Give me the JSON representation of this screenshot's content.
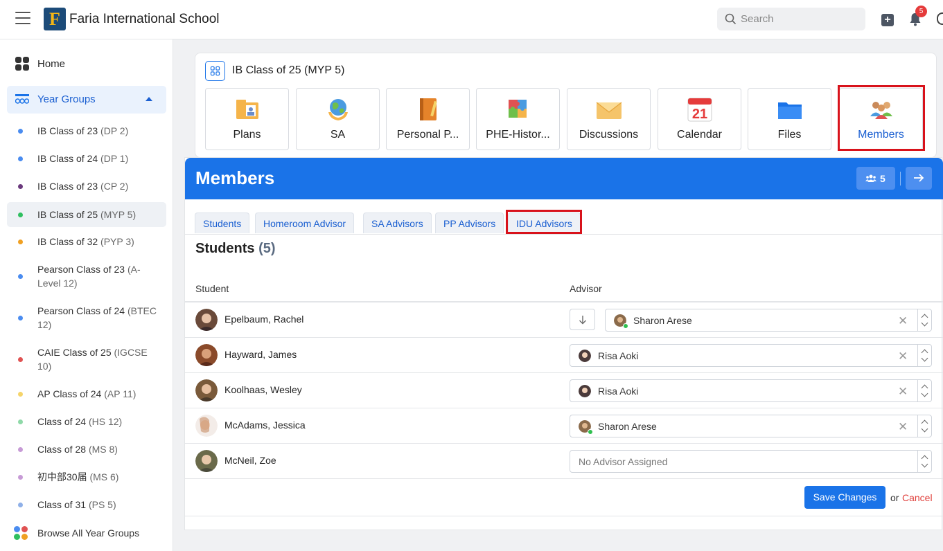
{
  "topbar": {
    "school_name": "Faria International School",
    "logo_letter": "F",
    "search_placeholder": "Search",
    "notification_count": "5"
  },
  "sidebar": {
    "home_label": "Home",
    "year_groups_label": "Year Groups",
    "items": [
      {
        "name": "IB Class of 23",
        "sub": "(DP 2)",
        "color": "#4a8cf0"
      },
      {
        "name": "IB Class of 24",
        "sub": "(DP 1)",
        "color": "#4a8cf0"
      },
      {
        "name": "IB Class of 23",
        "sub": "(CP 2)",
        "color": "#6b3a7d"
      },
      {
        "name": "IB Class of 25",
        "sub": "(MYP 5)",
        "color": "#2fbf60"
      },
      {
        "name": "IB Class of 32",
        "sub": "(PYP 3)",
        "color": "#f0a022"
      },
      {
        "name": "Pearson Class of 23",
        "sub": "(A-Level 12)",
        "color": "#4a8cf0"
      },
      {
        "name": "Pearson Class of 24",
        "sub": "(BTEC 12)",
        "color": "#4a8cf0"
      },
      {
        "name": "CAIE Class of 25",
        "sub": "(IGCSE 10)",
        "color": "#e05252"
      },
      {
        "name": "AP Class of 24",
        "sub": "(AP 11)",
        "color": "#f5d46a"
      },
      {
        "name": "Class of 24",
        "sub": "(HS 12)",
        "color": "#8fd9a8"
      },
      {
        "name": "Class of 28",
        "sub": "(MS 8)",
        "color": "#c79bd6"
      },
      {
        "name": "初中部30届",
        "sub": "(MS 6)",
        "color": "#c79bd6"
      },
      {
        "name": "Class of 31",
        "sub": "(PS 5)",
        "color": "#8fb0e8"
      }
    ],
    "browse_label": "Browse All Year Groups"
  },
  "class_header": {
    "title": "IB Class of 25 (MYP 5)",
    "tiles": [
      {
        "label": "Plans",
        "icon": "plans-icon"
      },
      {
        "label": "SA",
        "icon": "globe-hands-icon"
      },
      {
        "label": "Personal P...",
        "icon": "notebook-icon"
      },
      {
        "label": "PHE-Histor...",
        "icon": "puzzle-icon"
      },
      {
        "label": "Discussions",
        "icon": "envelope-icon"
      },
      {
        "label": "Calendar",
        "icon": "calendar-icon",
        "day": "21"
      },
      {
        "label": "Files",
        "icon": "folder-icon"
      },
      {
        "label": "Members",
        "icon": "members-icon"
      }
    ]
  },
  "members": {
    "title": "Members",
    "count": "5",
    "tabs": [
      "Students",
      "Homeroom Advisor",
      "SA Advisors",
      "PP Advisors",
      "IDU Advisors"
    ],
    "students_heading": "Students",
    "students_count": "(5)",
    "col_student": "Student",
    "col_advisor": "Advisor",
    "rows": [
      {
        "name": "Epelbaum, Rachel",
        "advisor": "Sharon Arese"
      },
      {
        "name": "Hayward, James",
        "advisor": "Risa Aoki"
      },
      {
        "name": "Koolhaas, Wesley",
        "advisor": "Risa Aoki"
      },
      {
        "name": "McAdams, Jessica",
        "advisor": "Sharon Arese"
      },
      {
        "name": "McNeil, Zoe",
        "advisor_placeholder": "No Advisor Assigned"
      }
    ],
    "save_label": "Save Changes",
    "or_label": "or",
    "cancel_label": "Cancel"
  }
}
